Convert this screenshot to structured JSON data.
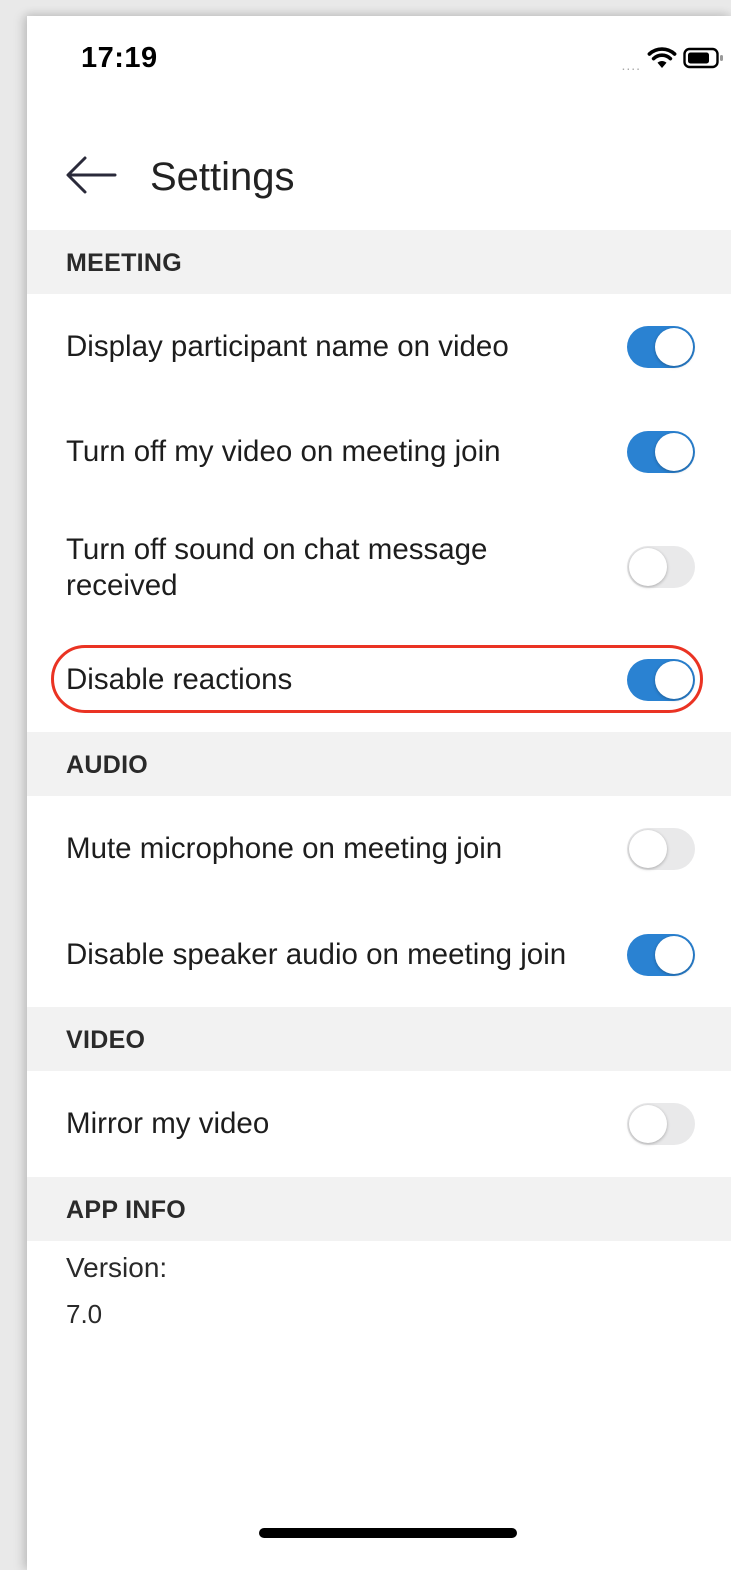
{
  "status_bar": {
    "time": "17:19",
    "signal": "....",
    "icons": [
      "wifi-icon",
      "battery-icon"
    ]
  },
  "header": {
    "title": "Settings",
    "back_icon": "arrow-left-icon"
  },
  "sections": {
    "meeting": {
      "title": "MEETING",
      "items": [
        {
          "label": "Display participant name on video",
          "enabled": true
        },
        {
          "label": "Turn off my video on meeting join",
          "enabled": true
        },
        {
          "label": "Turn off sound on chat message received",
          "enabled": false
        },
        {
          "label": "Disable reactions",
          "enabled": true,
          "highlighted": true
        }
      ]
    },
    "audio": {
      "title": "AUDIO",
      "items": [
        {
          "label": "Mute microphone on meeting join",
          "enabled": false
        },
        {
          "label": "Disable speaker audio on meeting join",
          "enabled": true
        }
      ]
    },
    "video": {
      "title": "VIDEO",
      "items": [
        {
          "label": "Mirror my video",
          "enabled": false
        }
      ]
    },
    "app_info": {
      "title": "APP INFO",
      "version_label": "Version:",
      "version_value": "7.0"
    }
  },
  "colors": {
    "toggle_on": "#2a82d2",
    "toggle_off": "#e9e9ea",
    "highlight": "#ea3323",
    "section_bg": "#f2f2f2"
  }
}
